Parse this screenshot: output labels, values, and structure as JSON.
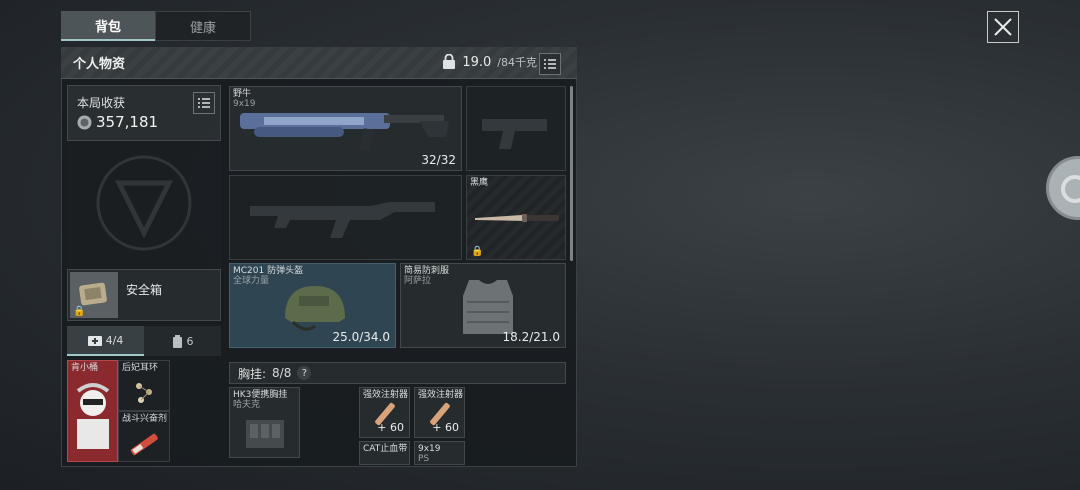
{
  "tabs": [
    {
      "label": "背包",
      "active": true
    },
    {
      "label": "健康",
      "active": false
    }
  ],
  "panel": {
    "title": "个人物资",
    "weight_current": "19.0",
    "weight_max": "/84千克"
  },
  "harvest": {
    "label": "本局收获",
    "value": "357,181"
  },
  "safe_box": {
    "label": "安全箱"
  },
  "pouch_tabs": [
    {
      "label": "4/4",
      "icon": "medkit-icon"
    },
    {
      "label": "6",
      "icon": "canister-icon"
    }
  ],
  "pouch_items": [
    {
      "name": "肯小桶",
      "icon": "mascot-figure-icon"
    },
    {
      "name": "后妃耳环",
      "icon": "earring-icon"
    },
    {
      "name": "战斗兴奋剂",
      "icon": "syringe-icon"
    }
  ],
  "primary_weapon": {
    "name": "野牛",
    "ammo_type": "9x19",
    "ammo": "32/32",
    "icon": "smg-icon"
  },
  "pistol_slot": {
    "icon": "pistol-silhouette-icon"
  },
  "secondary_weapon": {
    "icon": "rifle-silhouette-icon"
  },
  "melee": {
    "name": "黑鹰",
    "icon": "knife-icon"
  },
  "helmet": {
    "name": "MC201 防弹头盔",
    "brand": "全球力量",
    "durability": "25.0/34.0",
    "icon": "helmet-icon"
  },
  "armor": {
    "name": "简易防刺服",
    "brand": "阿萨拉",
    "durability": "18.2/21.0",
    "icon": "vest-icon"
  },
  "chest_rig": {
    "label": "胸挂:",
    "capacity": "8/8",
    "help": "?",
    "item_name": "HK3便携胸挂",
    "item_brand": "哈夫克",
    "icon": "chest-rig-icon"
  },
  "rig_items": [
    {
      "name": "强效注射器",
      "count": "+ 60",
      "icon": "injector-icon"
    },
    {
      "name": "强效注射器",
      "count": "+ 60",
      "icon": "injector-icon"
    },
    {
      "name": "CAT止血带",
      "count": "",
      "icon": "tourniquet-icon"
    },
    {
      "name": "9x19",
      "sub": "PS",
      "count": "",
      "icon": "ammo-icon"
    }
  ],
  "colors": {
    "accent": "#9ec7c5",
    "panel": "#181c1f",
    "slot_blue": "#2f4552"
  }
}
